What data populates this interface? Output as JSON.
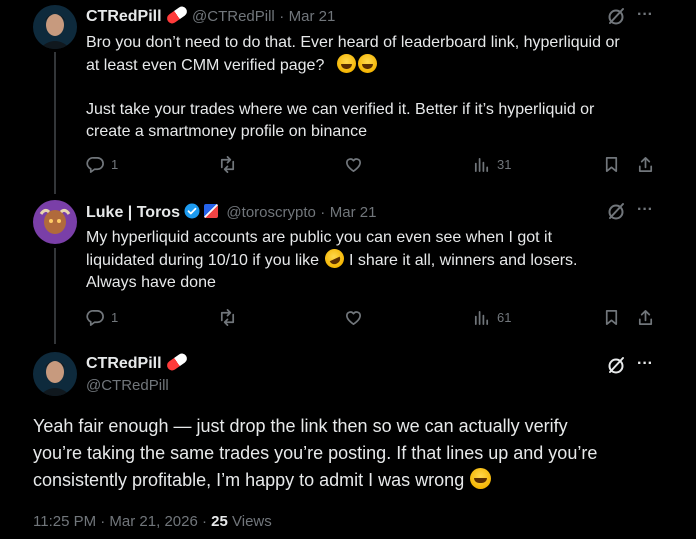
{
  "tweet1": {
    "name": "CTRedPill",
    "handle": "@CTRedPill",
    "date": "Mar 21",
    "line1": "Bro you don’t need to do that. Ever heard of leaderboard link, hyperliquid or",
    "line2": "at least even CMM verified page?",
    "line3": "Just take your trades where we can verified it. Better if it’s hyperliquid or",
    "line4": "create a smartmoney profile on binance",
    "replies": "1",
    "views": "31"
  },
  "tweet2": {
    "name": "Luke | Toros",
    "handle": "@toroscrypto",
    "date": "Mar 21",
    "line1": "My hyperliquid accounts are public you can even see when I got it",
    "line2a": "liquidated during 10/10 if you like",
    "line2b": "I share it all, winners and losers.",
    "line3": "Always have done",
    "replies": "1",
    "views": "61"
  },
  "main": {
    "name": "CTRedPill",
    "handle": "@CTRedPill",
    "line1": "Yeah fair enough — just drop the link then so we can actually verify",
    "line2": "you’re taking the same trades you’re posting. If that lines up and you’re",
    "line3": "consistently profitable, I’m happy to admit I was wrong",
    "timestamp": "11:25 PM · Mar 21, 2026 ·",
    "views_count": "25",
    "views_label": "Views"
  },
  "separator": "·",
  "more": "···"
}
